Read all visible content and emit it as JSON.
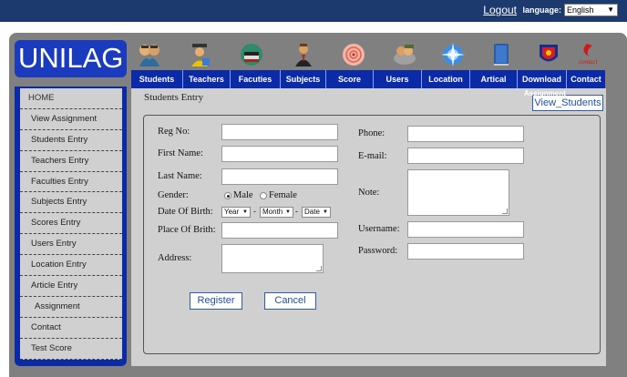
{
  "header": {
    "logout": "Logout",
    "language_label": "language:",
    "language_value": "English"
  },
  "brand": "UNILAG",
  "nav": {
    "icons": [
      "students-icon",
      "teachers-icon",
      "faculties-icon",
      "subjects-icon",
      "score-icon",
      "users-icon",
      "location-icon",
      "articles-icon",
      "download-icon",
      "contact-icon"
    ],
    "contact_logo_text": "contact",
    "items": [
      "Students",
      "Teachers",
      "Facuties",
      "Subjects",
      "Score",
      "Users",
      "Location",
      "Artical",
      "Download",
      "Contact"
    ]
  },
  "sidebar": {
    "items": [
      "HOME",
      "View Assignment",
      "Students Entry",
      "Teachers Entry",
      "Faculties Entry",
      "Subjects Entry",
      "Scores Entry",
      "Users Entry",
      "Location Entry",
      "Article Entry",
      "Assignment",
      "Contact",
      "Test Score"
    ]
  },
  "main": {
    "title": "Students Entry",
    "view_button": "View_Students",
    "view_ghost": "Assignment"
  },
  "form": {
    "reg_no": "Reg No:",
    "first_name": "First Name:",
    "last_name": "Last Name:",
    "gender": "Gender:",
    "male": "Male",
    "female": "Female",
    "dob": "Date Of Birth:",
    "year": "Year",
    "month": "Month",
    "date": "Date",
    "dash": "-",
    "place_of_birth": "Place Of Brith:",
    "address": "Address:",
    "phone": "Phone:",
    "email": "E-mail:",
    "note": "Note:",
    "username": "Username:",
    "password": "Password:",
    "register": "Register",
    "cancel": "Cancel"
  },
  "colors": {
    "topbar": "#1d3a6e",
    "brand_blue": "#1a3bbd",
    "nav_blue": "#0a2aa8",
    "panel_gray": "#d0d0d0"
  }
}
